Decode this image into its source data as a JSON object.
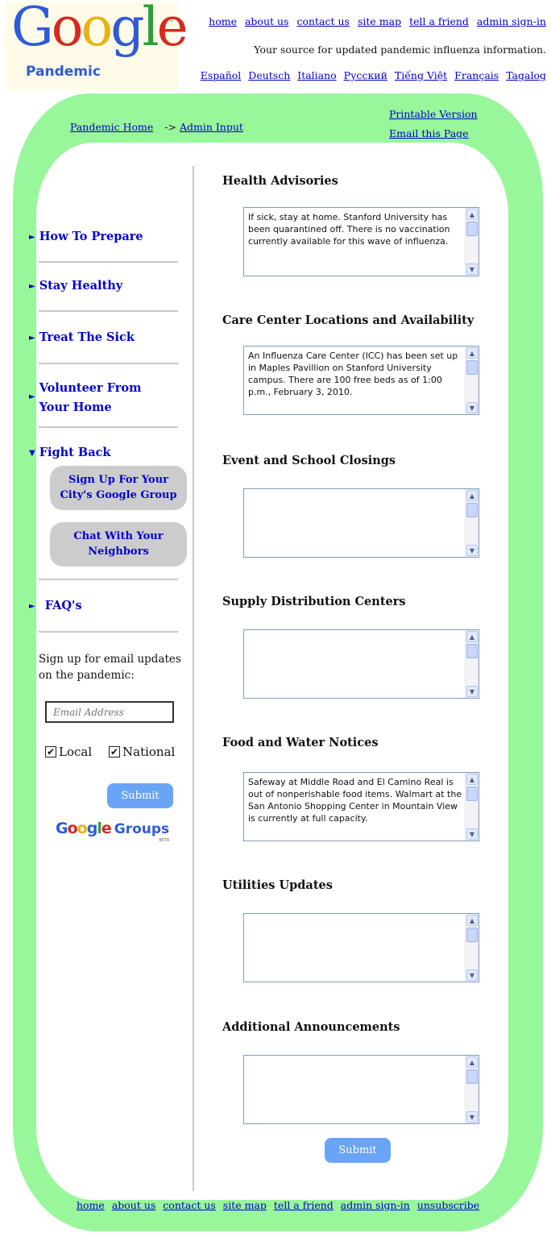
{
  "logo": {
    "word": "Google",
    "tm": "™",
    "sub": "Pandemic"
  },
  "top_nav": [
    "home",
    "about us",
    "contact us",
    "site map",
    "tell a friend",
    "admin sign-in"
  ],
  "tagline": "Your source for updated pandemic influenza information.",
  "languages": [
    "Español",
    "Deutsch",
    "Italiano",
    "Русский",
    "Tiếng Việt",
    "Français",
    "Tagalog"
  ],
  "breadcrumb": {
    "home": "Pandemic Home",
    "sep": "->",
    "current": "Admin Input"
  },
  "utility": {
    "printable": "Printable Version",
    "email": "Email this Page"
  },
  "sidebar": {
    "items": [
      {
        "label": "How To Prepare"
      },
      {
        "label": "Stay Healthy"
      },
      {
        "label": "Treat The Sick"
      },
      {
        "label": "Volunteer From Your Home",
        "line1": "Volunteer From",
        "line2": "Your Home"
      },
      {
        "label": "Fight Back"
      },
      {
        "label": "FAQ's"
      }
    ],
    "fight_back_buttons": [
      {
        "line1": "Sign Up For Your",
        "line2": "City's Google Group"
      },
      {
        "line1": "Chat With Your",
        "line2": "Neighbors"
      }
    ],
    "signup_text": "Sign up for email updates on the pandemic:",
    "email_placeholder": "Email Address",
    "checkboxes": [
      {
        "label": "Local",
        "checked": true
      },
      {
        "label": "National",
        "checked": true
      }
    ],
    "submit_label": "Submit",
    "groups_logo": {
      "google": "Google",
      "groups": "Groups",
      "beta": "BETA"
    }
  },
  "sections": [
    {
      "title": "Health Advisories",
      "text": "If sick, stay at home.  Stanford University has been quarantined off.  There is no vaccination currently available for this wave of influenza."
    },
    {
      "title": "Care Center Locations and Availability",
      "text": "An Influenza Care Center (ICC) has been set up in Maples Pavillion on Stanford University campus.  There are 100 free beds as of 1:00 p.m., February 3, 2010."
    },
    {
      "title": "Event and School Closings",
      "text": ""
    },
    {
      "title": "Supply Distribution Centers",
      "text": ""
    },
    {
      "title": "Food and Water Notices",
      "text": "Safeway at Middle Road and El Camino Real is out of nonperishable food items.  Walmart at the San Antonio Shopping Center in Mountain View is currently at full capacity."
    },
    {
      "title": "Utilities Updates",
      "text": ""
    },
    {
      "title": "Additional Announcements",
      "text": ""
    }
  ],
  "main_submit_label": "Submit",
  "footer_nav": [
    "home",
    "about us",
    "contact us",
    "site map",
    "tell a friend",
    "admin sign-in",
    "unsubscribe"
  ]
}
